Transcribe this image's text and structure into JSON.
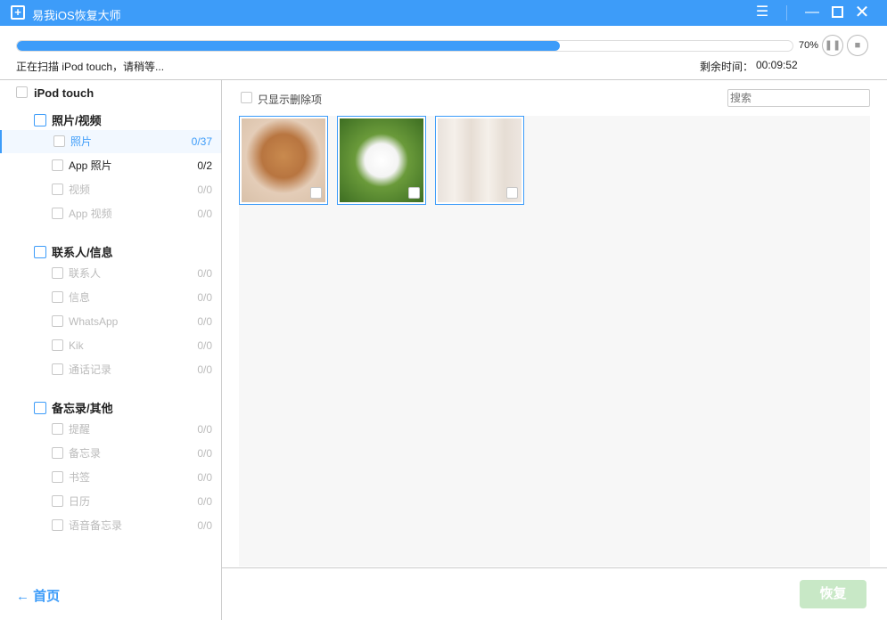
{
  "window": {
    "title": "易我iOS恢复大师",
    "icons": [
      "app-logo-icon",
      "menu-icon",
      "minimize-icon",
      "maximize-icon",
      "close-icon"
    ]
  },
  "scan": {
    "progress_percent": 70,
    "progress_label": "70%",
    "status": "正在扫描 iPod touch，请稍等...",
    "remaining_label": "剩余时间：",
    "remaining_time": "00:09:52"
  },
  "sidebar": {
    "device": "iPod touch",
    "groups": [
      {
        "title": "照片/视频",
        "icon": "image-icon",
        "items": [
          {
            "label": "照片",
            "count": "0/37",
            "state": "selected"
          },
          {
            "label": "App 照片",
            "count": "0/2",
            "state": "enabled"
          },
          {
            "label": "视频",
            "count": "0/0",
            "state": "disabled"
          },
          {
            "label": "App 视频",
            "count": "0/0",
            "state": "disabled"
          }
        ]
      },
      {
        "title": "联系人/信息",
        "icon": "clipboard-icon",
        "items": [
          {
            "label": "联系人",
            "count": "0/0",
            "state": "disabled"
          },
          {
            "label": "信息",
            "count": "0/0",
            "state": "disabled"
          },
          {
            "label": "WhatsApp",
            "count": "0/0",
            "state": "disabled"
          },
          {
            "label": "Kik",
            "count": "0/0",
            "state": "disabled"
          },
          {
            "label": "通话记录",
            "count": "0/0",
            "state": "disabled"
          }
        ]
      },
      {
        "title": "备忘录/其他",
        "icon": "notebook-icon",
        "items": [
          {
            "label": "提醒",
            "count": "0/0",
            "state": "disabled"
          },
          {
            "label": "备忘录",
            "count": "0/0",
            "state": "disabled"
          },
          {
            "label": "书签",
            "count": "0/0",
            "state": "disabled"
          },
          {
            "label": "日历",
            "count": "0/0",
            "state": "disabled"
          },
          {
            "label": "语音备忘录",
            "count": "0/0",
            "state": "disabled"
          }
        ]
      }
    ],
    "home": "首页"
  },
  "main": {
    "filter_label": "只显示删除项",
    "search_placeholder": "搜索",
    "thumbnails": 3,
    "restore_label": "恢复"
  },
  "colors": {
    "accent": "#3d9cf9",
    "restore_disabled": "#c8e8c6"
  }
}
